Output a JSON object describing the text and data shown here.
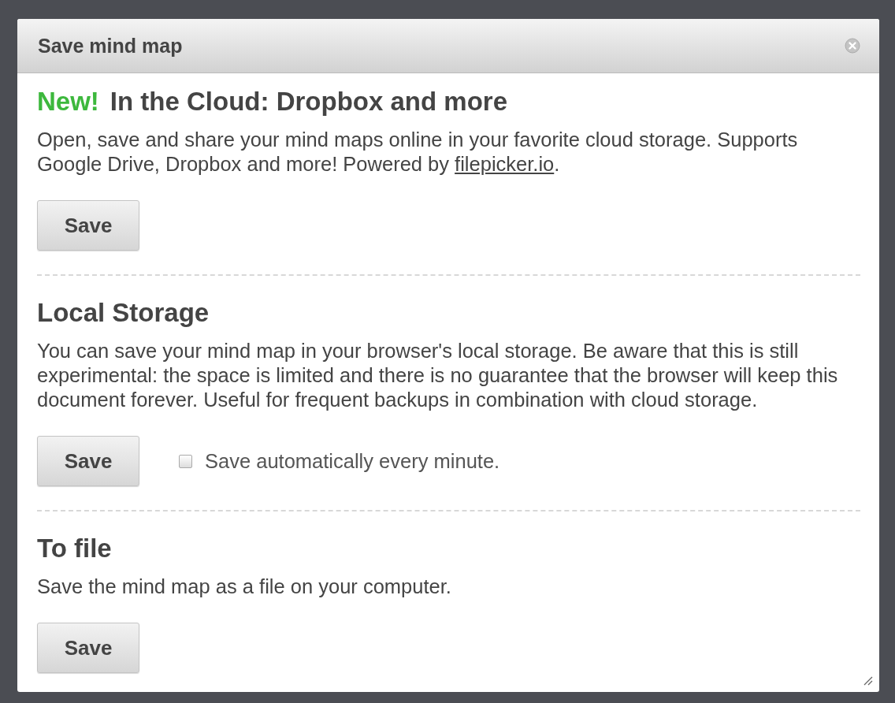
{
  "dialog": {
    "title": "Save mind map"
  },
  "sections": [
    {
      "badge": "New!",
      "heading": "In the Cloud: Dropbox and more",
      "description": [
        {
          "kind": "text",
          "text": "Open, save and share your mind maps online in your favorite cloud storage. Supports Google Drive, Dropbox and more! Powered by "
        },
        {
          "kind": "link",
          "text": "filepicker.io"
        },
        {
          "kind": "text",
          "text": "."
        }
      ],
      "button": "Save"
    },
    {
      "heading": "Local Storage",
      "description": [
        {
          "kind": "text",
          "text": "You can save your mind map in your browser's local storage. Be aware that this is still experimental: the space is limited and there is no guarantee that the browser will keep this document forever. Useful for frequent backups in combination with cloud storage."
        }
      ],
      "button": "Save",
      "checkbox": {
        "label": "Save automatically every minute.",
        "checked": false
      }
    },
    {
      "heading": "To file",
      "description": [
        {
          "kind": "text",
          "text": "Save the mind map as a file on your computer."
        }
      ],
      "button": "Save"
    }
  ]
}
